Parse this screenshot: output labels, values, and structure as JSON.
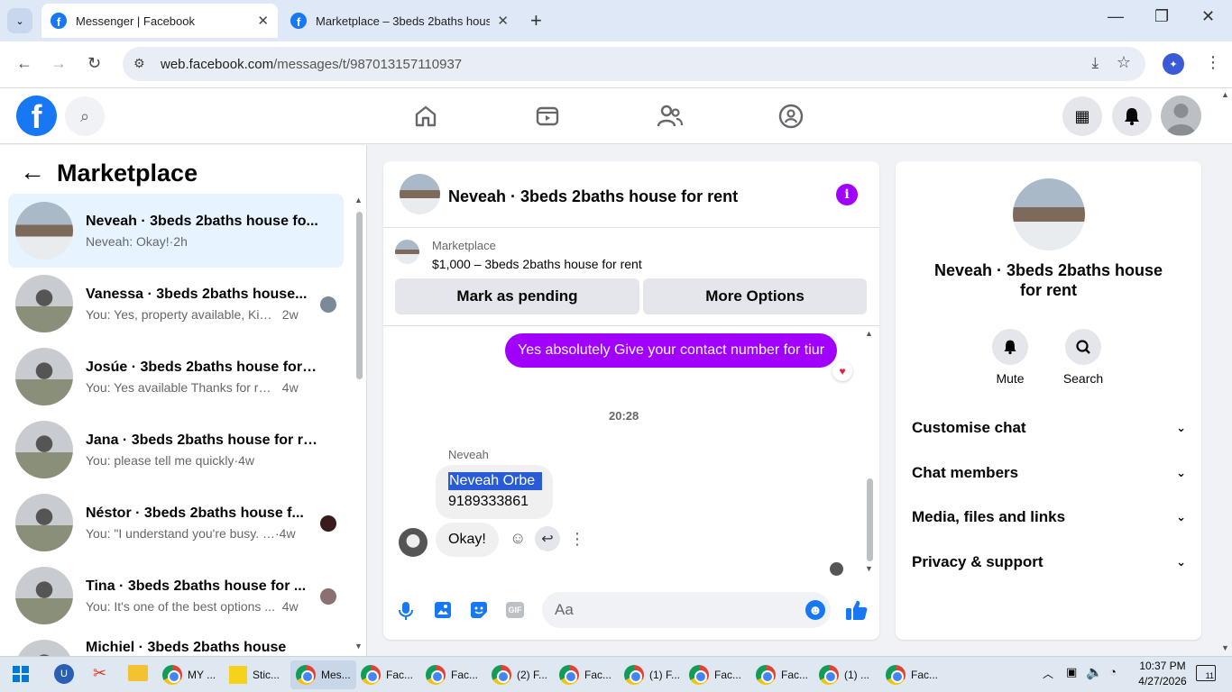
{
  "browser": {
    "tabs": [
      {
        "title": "Messenger | Facebook",
        "active": true
      },
      {
        "title": "Marketplace – 3beds 2baths house",
        "active": false
      }
    ],
    "url_host": "web.facebook.com",
    "url_path": "/messages/t/987013157110937"
  },
  "sidebar": {
    "title": "Marketplace",
    "conversations": [
      {
        "name": "Neveah · 3beds 2baths house fo...",
        "preview": "Neveah: Okay!",
        "time": "2h",
        "selected": true
      },
      {
        "name": "Vanessa · 3beds 2baths house...",
        "preview": "You: Yes, property available, Kin...",
        "time": "2w"
      },
      {
        "name": "Josúe · 3beds 2baths house for r...",
        "preview": "You: Yes available Thanks for reachi...",
        "time": "4w"
      },
      {
        "name": "Jana · 3beds 2baths house for re...",
        "preview": "You: please tell me quickly",
        "time": "4w"
      },
      {
        "name": "Néstor · 3beds 2baths house f...",
        "preview": "You: \"I understand you're busy. I...",
        "time": "4w"
      },
      {
        "name": "Tina · 3beds 2baths house for ...",
        "preview": "You: It's one of the best options ...",
        "time": "4w"
      },
      {
        "name": "Michiel · 3beds 2baths house",
        "preview": "",
        "time": ""
      }
    ]
  },
  "chat": {
    "title": "Neveah · 3beds 2baths house for rent",
    "listing_source": "Marketplace",
    "listing": "$1,000 – 3beds 2baths house for rent",
    "mark_pending": "Mark as pending",
    "more_options": "More Options",
    "sent_message": "Yes absolutely Give your contact number for tiur",
    "reaction": "❤️",
    "timestamp": "20:28",
    "sender": "Neveah",
    "received_line1": "Neveah Orbe",
    "received_line2": "9189333861",
    "received_message": "Okay!",
    "composer_placeholder": "Aa"
  },
  "info": {
    "title": "Neveah · 3beds 2baths house for rent",
    "mute": "Mute",
    "search": "Search",
    "sections": [
      "Customise chat",
      "Chat members",
      "Media, files and links",
      "Privacy & support"
    ]
  },
  "taskbar": {
    "items": [
      "MY ...",
      "Stic...",
      "Mes...",
      "Fac...",
      "Fac...",
      "(2) F...",
      "Fac...",
      "(1) F...",
      "Fac...",
      "Fac...",
      "(1) ...",
      "Fac..."
    ],
    "time": "10:37 PM",
    "date": "4/27/2026",
    "notifications": "11"
  },
  "colors": {
    "brand": "#1877f2",
    "sent_bubble": "#a100ff",
    "selection": "#2a5bd7"
  }
}
